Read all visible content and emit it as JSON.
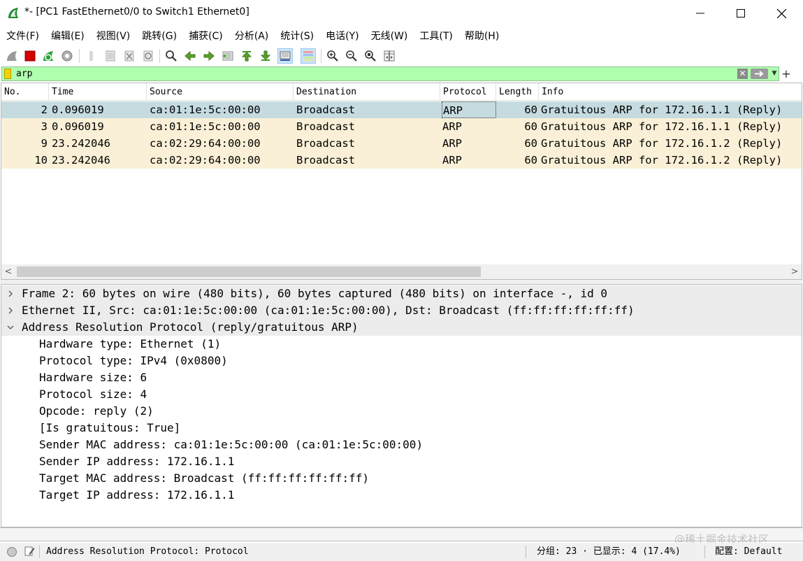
{
  "window": {
    "title": "*- [PC1 FastEthernet0/0 to Switch1 Ethernet0]",
    "app_icon": "wireshark-fin-icon",
    "controls": [
      "minimize-icon",
      "maximize-icon",
      "close-icon"
    ]
  },
  "menu": [
    "文件(F)",
    "编辑(E)",
    "视图(V)",
    "跳转(G)",
    "捕获(C)",
    "分析(A)",
    "统计(S)",
    "电话(Y)",
    "无线(W)",
    "工具(T)",
    "帮助(H)"
  ],
  "toolbar": {
    "icons": [
      "start-capture-icon",
      "stop-capture-icon",
      "restart-capture-icon",
      "capture-options-icon",
      "open-file-icon",
      "save-file-icon",
      "close-file-icon",
      "reload-file-icon",
      "find-packet-icon",
      "go-back-icon",
      "go-forward-icon",
      "go-to-packet-icon",
      "go-first-icon",
      "go-last-icon",
      "autoscroll-icon",
      "colorize-icon",
      "zoom-in-icon",
      "zoom-out-icon",
      "zoom-normal-icon",
      "resize-columns-icon"
    ]
  },
  "filter": {
    "value": "arp"
  },
  "packet_list": {
    "columns": [
      "No.",
      "Time",
      "Source",
      "Destination",
      "Protocol",
      "Length",
      "Info"
    ],
    "rows": [
      {
        "no": "2",
        "time": "0.096019",
        "source": "ca:01:1e:5c:00:00",
        "destination": "Broadcast",
        "protocol": "ARP",
        "length": "60",
        "info": "Gratuitous ARP for 172.16.1.1 (Reply)",
        "selected": true
      },
      {
        "no": "3",
        "time": "0.096019",
        "source": "ca:01:1e:5c:00:00",
        "destination": "Broadcast",
        "protocol": "ARP",
        "length": "60",
        "info": "Gratuitous ARP for 172.16.1.1 (Reply)",
        "selected": false
      },
      {
        "no": "9",
        "time": "23.242046",
        "source": "ca:02:29:64:00:00",
        "destination": "Broadcast",
        "protocol": "ARP",
        "length": "60",
        "info": "Gratuitous ARP for 172.16.1.2 (Reply)",
        "selected": false
      },
      {
        "no": "10",
        "time": "23.242046",
        "source": "ca:02:29:64:00:00",
        "destination": "Broadcast",
        "protocol": "ARP",
        "length": "60",
        "info": "Gratuitous ARP for 172.16.1.2 (Reply)",
        "selected": false
      }
    ],
    "colors": {
      "selected_row": "#c5dbe0",
      "arp_row": "#faf0d7"
    }
  },
  "details": [
    {
      "text": "Frame 2: 60 bytes on wire (480 bits), 60 bytes captured (480 bits) on interface -, id 0",
      "level": 0,
      "expander": "collapsed"
    },
    {
      "text": "Ethernet II, Src: ca:01:1e:5c:00:00 (ca:01:1e:5c:00:00), Dst: Broadcast (ff:ff:ff:ff:ff:ff)",
      "level": 0,
      "expander": "collapsed"
    },
    {
      "text": "Address Resolution Protocol (reply/gratuitous ARP)",
      "level": 0,
      "expander": "expanded"
    },
    {
      "text": "Hardware type: Ethernet (1)",
      "level": 1
    },
    {
      "text": "Protocol type: IPv4 (0x0800)",
      "level": 1
    },
    {
      "text": "Hardware size: 6",
      "level": 1
    },
    {
      "text": "Protocol size: 4",
      "level": 1
    },
    {
      "text": "Opcode: reply (2)",
      "level": 1
    },
    {
      "text": "[Is gratuitous: True]",
      "level": 1
    },
    {
      "text": "Sender MAC address: ca:01:1e:5c:00:00 (ca:01:1e:5c:00:00)",
      "level": 1
    },
    {
      "text": "Sender IP address: 172.16.1.1",
      "level": 1
    },
    {
      "text": "Target MAC address: Broadcast (ff:ff:ff:ff:ff:ff)",
      "level": 1
    },
    {
      "text": "Target IP address: 172.16.1.1",
      "level": 1
    }
  ],
  "status": {
    "field_info": "Address Resolution Protocol: Protocol",
    "packets": "分组: 23 · 已显示: 4 (17.4%)",
    "profile": "配置: Default",
    "watermark": "@稀土掘金技术社区"
  }
}
